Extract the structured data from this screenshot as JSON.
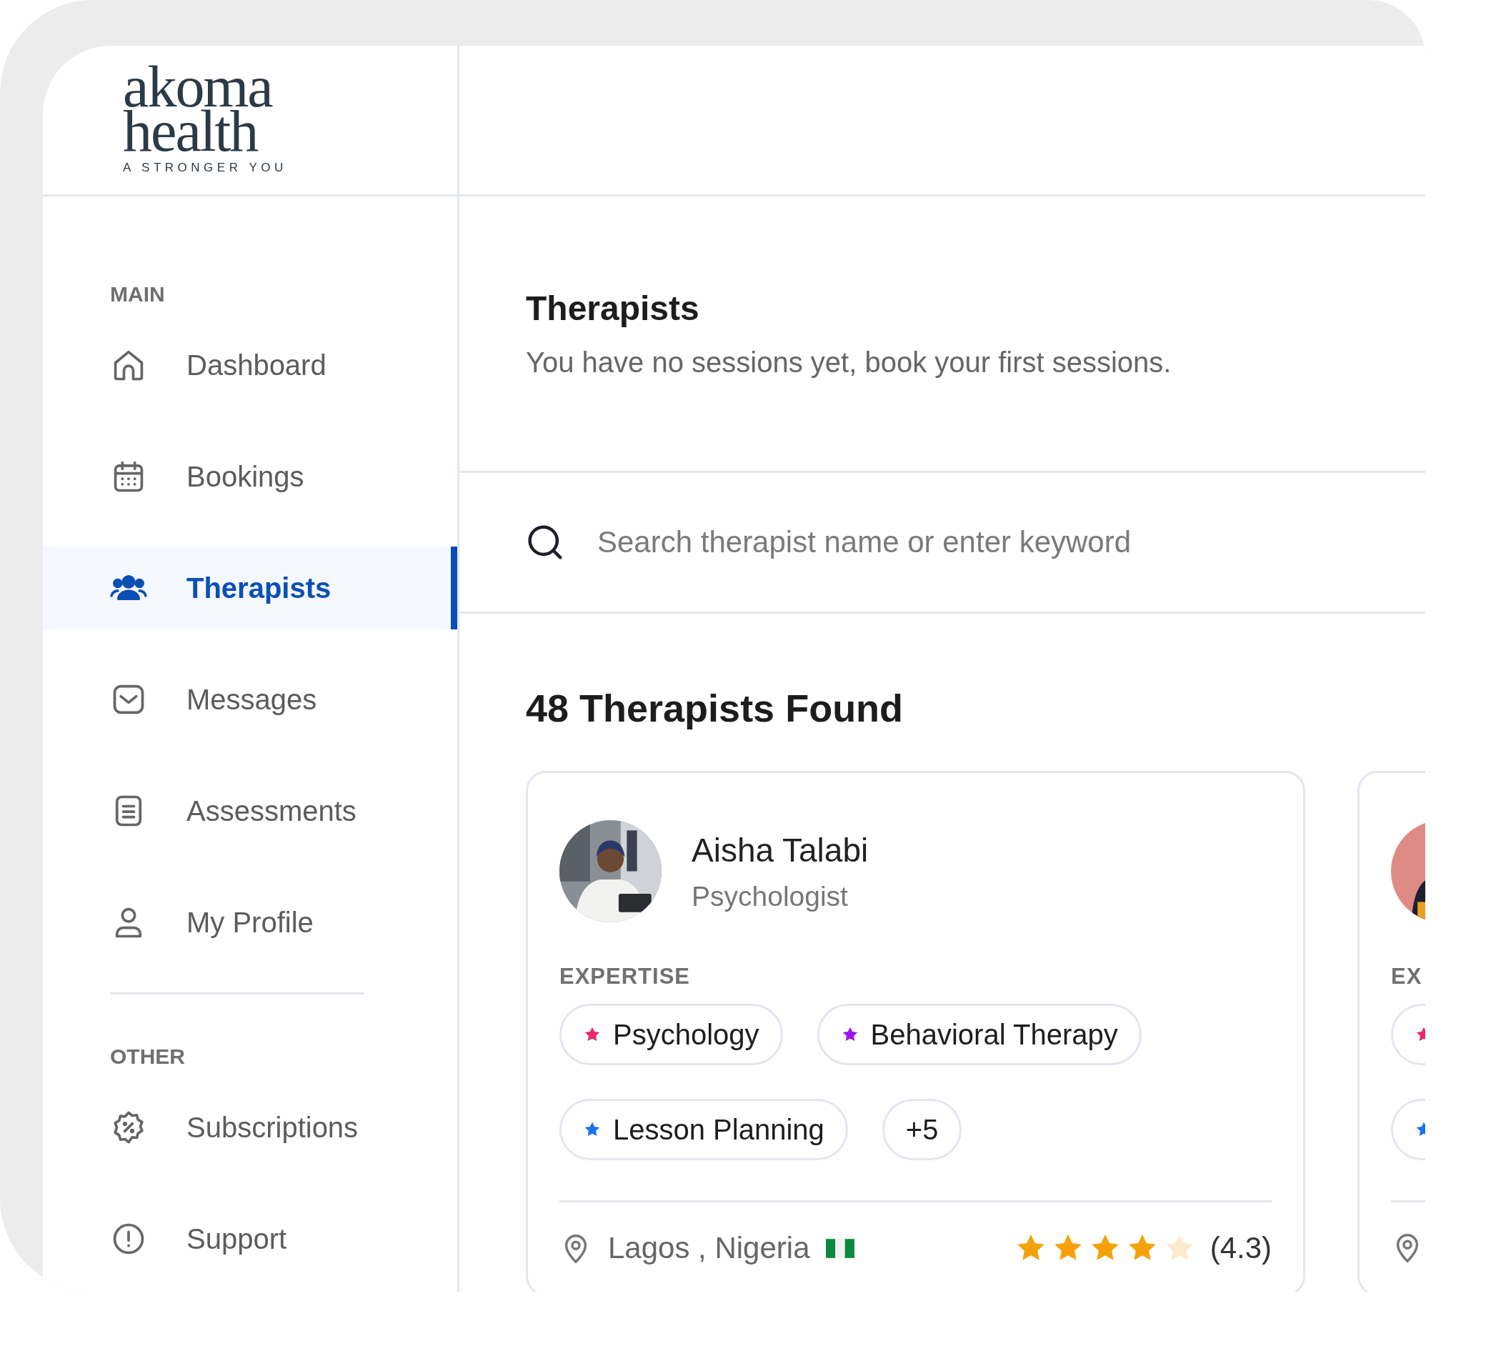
{
  "logo": {
    "line1": "akoma",
    "line2": "health",
    "tagline": "A STRONGER YOU"
  },
  "sidebar": {
    "sections": [
      {
        "heading": "MAIN",
        "items": [
          {
            "label": "Dashboard",
            "selected": false
          },
          {
            "label": "Bookings",
            "selected": false
          },
          {
            "label": "Therapists",
            "selected": true
          },
          {
            "label": "Messages",
            "selected": false
          },
          {
            "label": "Assessments",
            "selected": false
          },
          {
            "label": "My Profile",
            "selected": false
          }
        ]
      },
      {
        "heading": "OTHER",
        "items": [
          {
            "label": "Subscriptions",
            "selected": false
          },
          {
            "label": "Support",
            "selected": false
          }
        ]
      }
    ]
  },
  "page": {
    "title": "Therapists",
    "subtitle": "You have no sessions yet, book your first sessions."
  },
  "search": {
    "placeholder": "Search therapist name or enter keyword"
  },
  "results": {
    "title": "48 Therapists Found"
  },
  "therapists": [
    {
      "name": "Aisha Talabi",
      "role": "Psychologist",
      "expertise_label": "EXPERTISE",
      "tags": [
        {
          "kind": "topic",
          "label": "Psychology",
          "color": "#f0266f"
        },
        {
          "kind": "topic",
          "label": "Behavioral Therapy",
          "color": "#9b14f5"
        },
        {
          "kind": "topic",
          "label": "Lesson Planning",
          "color": "#1a73f0"
        },
        {
          "kind": "more",
          "label": "+5"
        }
      ],
      "location": "Lagos , Nigeria",
      "stars": 4,
      "rating": "(4.3)"
    },
    {
      "expertise_label": "EX",
      "tags": [
        {
          "kind": "topic",
          "color": "#f0266f"
        },
        {
          "kind": "topic",
          "color": "#1a73f0"
        }
      ]
    }
  ]
}
